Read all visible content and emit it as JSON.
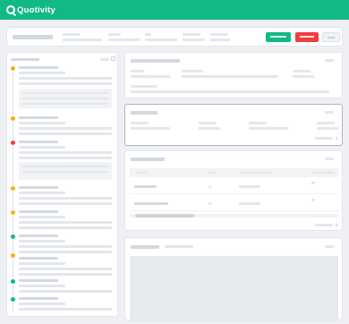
{
  "app": {
    "name": "Quotivity"
  },
  "colors": {
    "brand": "#12b886",
    "danger": "#f03e3e",
    "warning": "#fab005",
    "selected_border": "#adb5bd"
  },
  "icons": [
    "logo-icon",
    "expand-icon",
    "chevron-right-icon"
  ],
  "timeline": {
    "status_colors": [
      "warning",
      "warning",
      "danger",
      "warning",
      "warning",
      "brand",
      "warning",
      "brand",
      "brand"
    ]
  }
}
